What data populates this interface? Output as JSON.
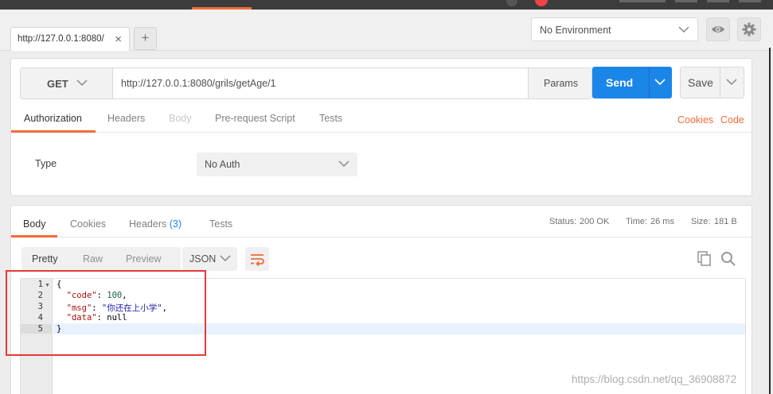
{
  "tabs": [
    {
      "label": "http://127.0.0.1:8080/",
      "close": "×"
    }
  ],
  "new_tab_label": "+",
  "environment": {
    "selected": "No Environment"
  },
  "request": {
    "method": "GET",
    "url": "http://127.0.0.1:8080/grils/getAge/1",
    "params_label": "Params",
    "send_label": "Send",
    "save_label": "Save"
  },
  "request_tabs": [
    {
      "label": "Authorization",
      "state": "active"
    },
    {
      "label": "Headers",
      "state": "normal"
    },
    {
      "label": "Body",
      "state": "disabled"
    },
    {
      "label": "Pre-request Script",
      "state": "normal"
    },
    {
      "label": "Tests",
      "state": "normal"
    }
  ],
  "request_links": {
    "cookies": "Cookies",
    "code": "Code"
  },
  "auth": {
    "type_label": "Type",
    "selected": "No Auth"
  },
  "response_tabs": [
    {
      "label": "Body",
      "state": "active"
    },
    {
      "label": "Cookies",
      "state": "normal"
    },
    {
      "label": "Headers",
      "count": "(3)",
      "state": "normal"
    },
    {
      "label": "Tests",
      "state": "normal"
    }
  ],
  "status": {
    "status_label": "Status:",
    "status_value": "200 OK",
    "time_label": "Time:",
    "time_value": "26 ms",
    "size_label": "Size:",
    "size_value": "181 B"
  },
  "format_buttons": [
    {
      "label": "Pretty",
      "state": "active"
    },
    {
      "label": "Raw",
      "state": "normal"
    },
    {
      "label": "Preview",
      "state": "normal"
    }
  ],
  "format_select": "JSON",
  "editor": {
    "line_numbers": [
      "1",
      "2",
      "3",
      "4",
      "5"
    ],
    "lines": {
      "l1": "{",
      "l2_key": "\"code\"",
      "l2_sep": ": ",
      "l2_val": "100",
      "l2_end": ",",
      "l3_key": "\"msg\"",
      "l3_sep": ": ",
      "l3_val": "\"你还在上小学\"",
      "l3_end": ",",
      "l4_key": "\"data\"",
      "l4_sep": ": ",
      "l4_val": "null",
      "l5": "}"
    }
  },
  "watermark": "https://blog.csdn.net/qq_36908872",
  "colors": {
    "accent": "#f26b3a",
    "send": "#1a86e8",
    "annotation_box": "#e53935"
  }
}
